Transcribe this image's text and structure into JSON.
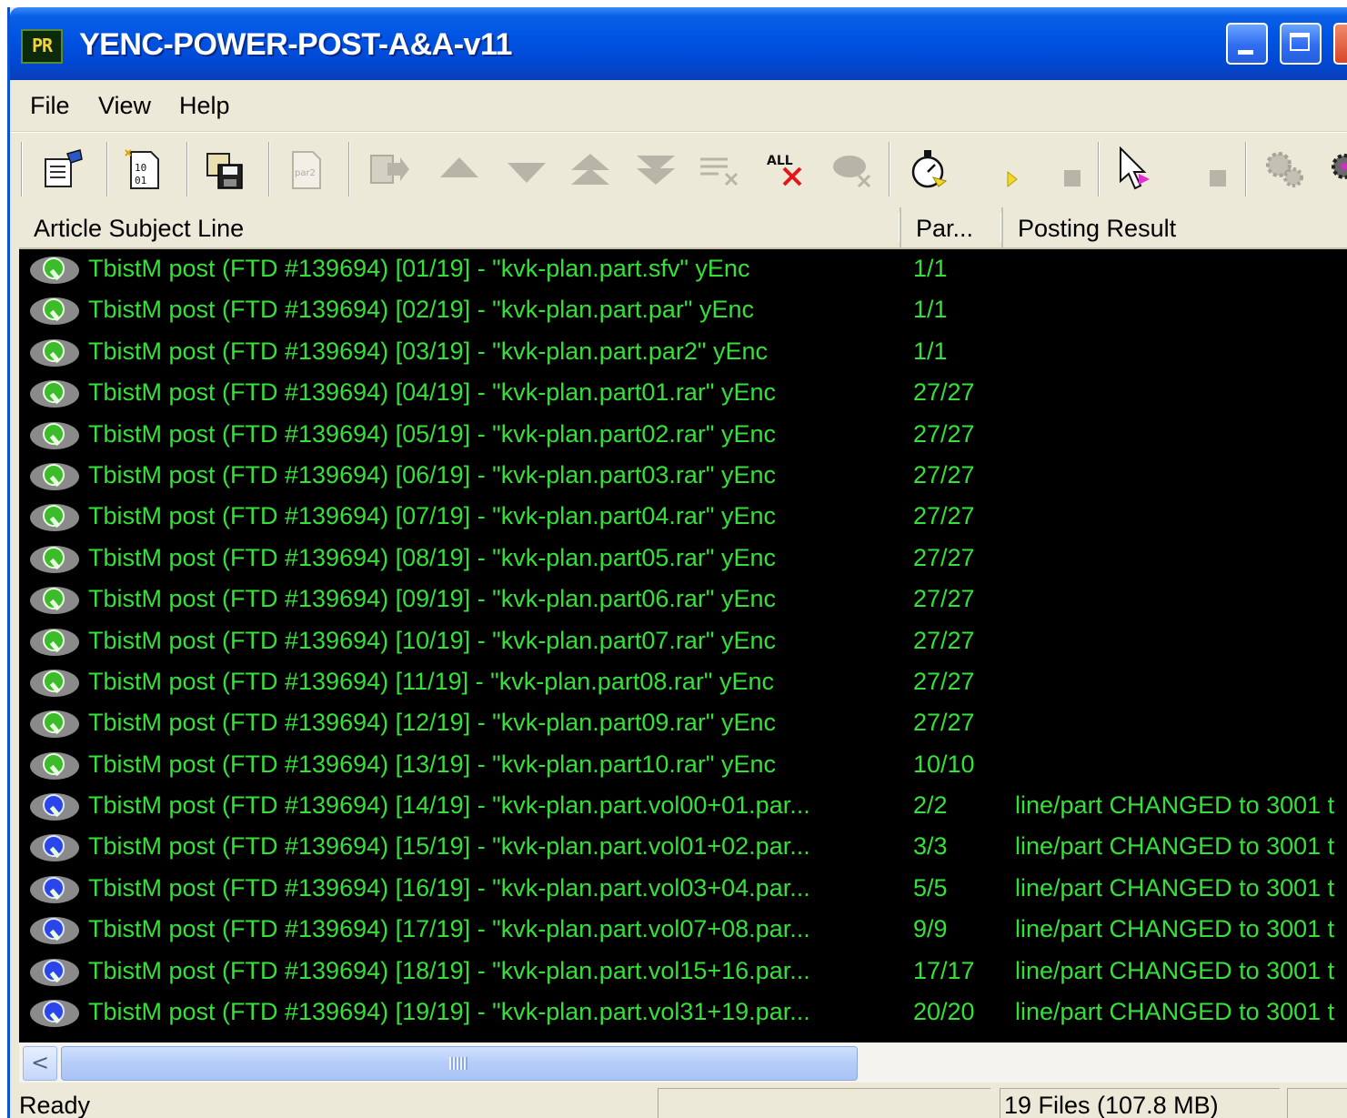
{
  "window": {
    "title": "YENC-POWER-POST-A&A-v11",
    "icon_label": "PR"
  },
  "menu": {
    "items": [
      {
        "label": "File"
      },
      {
        "label": "View"
      },
      {
        "label": "Help"
      }
    ]
  },
  "toolbar": {
    "all_icon_label": "ALL",
    "par_icon_label": "par2"
  },
  "columns": [
    {
      "label": "Article Subject Line"
    },
    {
      "label": "Par..."
    },
    {
      "label": "Posting Result"
    }
  ],
  "rows": [
    {
      "subject": "TbistM post (FTD #139694) [01/19] - \"kvk-plan.part.sfv\" yEnc",
      "parts": "1/1",
      "result": "",
      "status": "green"
    },
    {
      "subject": "TbistM post (FTD #139694) [02/19] - \"kvk-plan.part.par\" yEnc",
      "parts": "1/1",
      "result": "",
      "status": "green"
    },
    {
      "subject": "TbistM post (FTD #139694) [03/19] - \"kvk-plan.part.par2\" yEnc",
      "parts": "1/1",
      "result": "",
      "status": "green"
    },
    {
      "subject": "TbistM post (FTD #139694) [04/19] - \"kvk-plan.part01.rar\" yEnc",
      "parts": "27/27",
      "result": "",
      "status": "green"
    },
    {
      "subject": "TbistM post (FTD #139694) [05/19] - \"kvk-plan.part02.rar\" yEnc",
      "parts": "27/27",
      "result": "",
      "status": "green"
    },
    {
      "subject": "TbistM post (FTD #139694) [06/19] - \"kvk-plan.part03.rar\" yEnc",
      "parts": "27/27",
      "result": "",
      "status": "green"
    },
    {
      "subject": "TbistM post (FTD #139694) [07/19] - \"kvk-plan.part04.rar\" yEnc",
      "parts": "27/27",
      "result": "",
      "status": "green"
    },
    {
      "subject": "TbistM post (FTD #139694) [08/19] - \"kvk-plan.part05.rar\" yEnc",
      "parts": "27/27",
      "result": "",
      "status": "green"
    },
    {
      "subject": "TbistM post (FTD #139694) [09/19] - \"kvk-plan.part06.rar\" yEnc",
      "parts": "27/27",
      "result": "",
      "status": "green"
    },
    {
      "subject": "TbistM post (FTD #139694) [10/19] - \"kvk-plan.part07.rar\" yEnc",
      "parts": "27/27",
      "result": "",
      "status": "green"
    },
    {
      "subject": "TbistM post (FTD #139694) [11/19] - \"kvk-plan.part08.rar\" yEnc",
      "parts": "27/27",
      "result": "",
      "status": "green"
    },
    {
      "subject": "TbistM post (FTD #139694) [12/19] - \"kvk-plan.part09.rar\" yEnc",
      "parts": "27/27",
      "result": "",
      "status": "green"
    },
    {
      "subject": "TbistM post (FTD #139694) [13/19] - \"kvk-plan.part10.rar\" yEnc",
      "parts": "10/10",
      "result": "",
      "status": "green"
    },
    {
      "subject": "TbistM post (FTD #139694) [14/19] - \"kvk-plan.part.vol00+01.par...",
      "parts": "2/2",
      "result": "line/part CHANGED to 3001 t",
      "status": "blue"
    },
    {
      "subject": "TbistM post (FTD #139694) [15/19] - \"kvk-plan.part.vol01+02.par...",
      "parts": "3/3",
      "result": "line/part CHANGED to 3001 t",
      "status": "blue"
    },
    {
      "subject": "TbistM post (FTD #139694) [16/19] - \"kvk-plan.part.vol03+04.par...",
      "parts": "5/5",
      "result": "line/part CHANGED to 3001 t",
      "status": "blue"
    },
    {
      "subject": "TbistM post (FTD #139694) [17/19] - \"kvk-plan.part.vol07+08.par...",
      "parts": "9/9",
      "result": "line/part CHANGED to 3001 t",
      "status": "blue"
    },
    {
      "subject": "TbistM post (FTD #139694) [18/19] - \"kvk-plan.part.vol15+16.par...",
      "parts": "17/17",
      "result": "line/part CHANGED to 3001 t",
      "status": "blue"
    },
    {
      "subject": "TbistM post (FTD #139694) [19/19] - \"kvk-plan.part.vol31+19.par...",
      "parts": "20/20",
      "result": "line/part CHANGED to 3001 t",
      "status": "blue"
    }
  ],
  "scrollbar": {
    "left_arrow": "<"
  },
  "status": {
    "text": "Ready",
    "files": "19 Files (107.8 MB)"
  },
  "colors": {
    "list_background": "#000000",
    "row_text": "#36e03a",
    "titlebar": "#0054e3"
  }
}
